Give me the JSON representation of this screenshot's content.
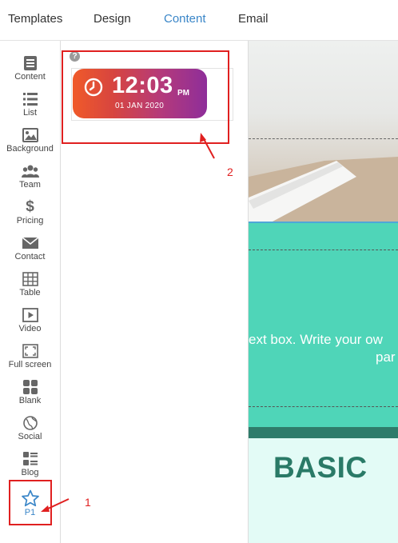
{
  "topnav": {
    "tabs": [
      {
        "label": "Templates"
      },
      {
        "label": "Design"
      },
      {
        "label": "Content"
      },
      {
        "label": "Email"
      }
    ],
    "active_tab": "Content"
  },
  "sidebar": {
    "items": [
      {
        "label": "Content",
        "icon": "content-icon"
      },
      {
        "label": "List",
        "icon": "list-icon"
      },
      {
        "label": "Background",
        "icon": "image-icon"
      },
      {
        "label": "Team",
        "icon": "team-icon"
      },
      {
        "label": "Pricing",
        "icon": "dollar-icon"
      },
      {
        "label": "Contact",
        "icon": "envelope-icon"
      },
      {
        "label": "Table",
        "icon": "table-icon"
      },
      {
        "label": "Video",
        "icon": "play-icon"
      },
      {
        "label": "Full screen",
        "icon": "fullscreen-icon"
      },
      {
        "label": "Blank",
        "icon": "blank-grid-icon"
      },
      {
        "label": "Social",
        "icon": "globe-icon"
      },
      {
        "label": "Blog",
        "icon": "blog-icon"
      },
      {
        "label": "P1",
        "icon": "star-icon"
      }
    ]
  },
  "panel": {
    "help": "?",
    "clock_widget": {
      "time": "12:03",
      "ampm": "PM",
      "date": "01 JAN 2020"
    }
  },
  "annotations": {
    "marker_1": "1",
    "marker_2": "2"
  },
  "canvas": {
    "hero_text_line1": "ext box. Write your ow",
    "hero_text_line2": "par",
    "pricing_title": "BASIC"
  },
  "colors": {
    "accent": "#3a86c8",
    "annotation": "#e02020",
    "teal": "#4fd5b8",
    "teal_dark": "#2f7c6b",
    "clock_gradient_start": "#f05a2a",
    "clock_gradient_end": "#8e2e9a"
  }
}
